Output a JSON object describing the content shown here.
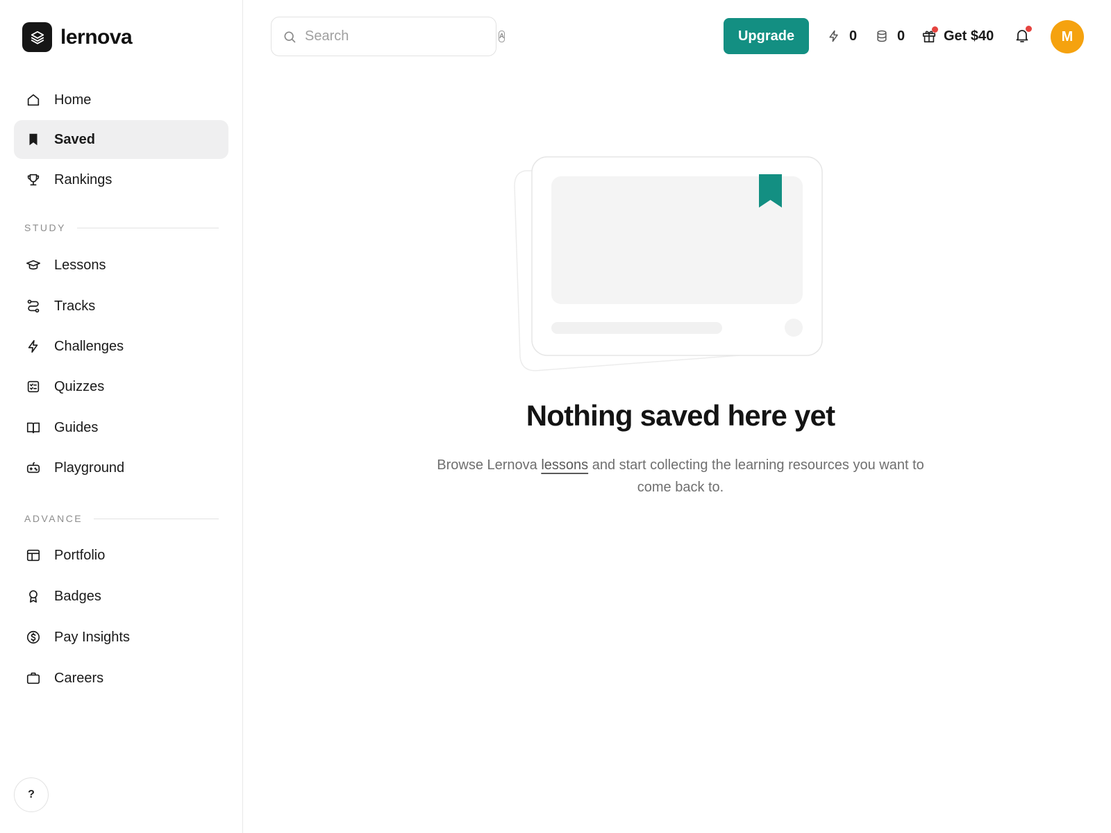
{
  "app": {
    "name": "lernova"
  },
  "sidebar": {
    "primary": [
      {
        "label": "Home",
        "icon": "home-icon"
      },
      {
        "label": "Saved",
        "icon": "bookmark-icon",
        "active": true
      },
      {
        "label": "Rankings",
        "icon": "trophy-icon"
      }
    ],
    "sections": [
      {
        "label": "STUDY",
        "items": [
          {
            "label": "Lessons",
            "icon": "graduation-cap-icon"
          },
          {
            "label": "Tracks",
            "icon": "route-icon"
          },
          {
            "label": "Challenges",
            "icon": "lightning-icon"
          },
          {
            "label": "Quizzes",
            "icon": "checklist-icon"
          },
          {
            "label": "Guides",
            "icon": "book-open-icon"
          },
          {
            "label": "Playground",
            "icon": "gamepad-icon"
          }
        ]
      },
      {
        "label": "ADVANCE",
        "items": [
          {
            "label": "Portfolio",
            "icon": "layout-icon"
          },
          {
            "label": "Badges",
            "icon": "award-icon"
          },
          {
            "label": "Pay Insights",
            "icon": "dollar-circle-icon"
          },
          {
            "label": "Careers",
            "icon": "briefcase-icon"
          }
        ]
      }
    ],
    "help_label": "?"
  },
  "topbar": {
    "search_placeholder": "Search",
    "search_shortcut": "A",
    "upgrade_label": "Upgrade",
    "energy_count": "0",
    "coins_count": "0",
    "referral_label": "Get $40",
    "avatar_initial": "M"
  },
  "empty_state": {
    "title": "Nothing saved here yet",
    "desc_before": "Browse Lernova ",
    "desc_link": "lessons",
    "desc_after": " and start collecting the learning resources you want to come back to."
  },
  "colors": {
    "accent": "#138f82",
    "avatar": "#f5a20f",
    "notification_dot": "#e5433f",
    "active_nav_bg": "#efeff0"
  }
}
